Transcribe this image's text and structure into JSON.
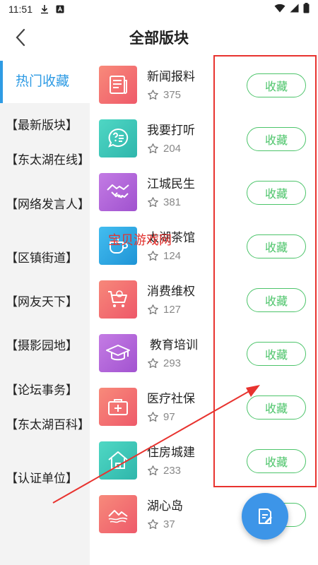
{
  "status_bar": {
    "time": "11:51"
  },
  "header": {
    "title": "全部版块"
  },
  "sidebar": {
    "items": [
      {
        "label": "热门收藏",
        "active": true
      },
      {
        "label": "【最新版块】"
      },
      {
        "label": "【东太湖在线】"
      },
      {
        "label": "【网络发言人】"
      },
      {
        "label": "【区镇街道】"
      },
      {
        "label": "【网友天下】"
      },
      {
        "label": "【摄影园地】"
      },
      {
        "label": "【论坛事务】"
      },
      {
        "label": "【东太湖百科】"
      },
      {
        "label": "【认证单位】"
      }
    ]
  },
  "forums": [
    {
      "name": "新闻报料",
      "count": "375",
      "button": "收藏",
      "icon": "newspaper-icon",
      "color": "#f36b6b"
    },
    {
      "name": "我要打听",
      "count": "204",
      "button": "收藏",
      "icon": "chat-question-icon",
      "color": "#3ec7b8"
    },
    {
      "name": "江城民生",
      "count": "381",
      "button": "收藏",
      "icon": "handshake-icon",
      "color": "#b468d8"
    },
    {
      "name": "太湖茶馆",
      "count": "124",
      "button": "收藏",
      "icon": "teacup-icon",
      "color": "#2ea7e0"
    },
    {
      "name": "消费维权",
      "count": "127",
      "button": "收藏",
      "icon": "shopping-cart-icon",
      "color": "#f26a6a"
    },
    {
      "name": "教育培训",
      "count": "293",
      "button": "收藏",
      "icon": "graduation-cap-icon",
      "color": "#b86ad8"
    },
    {
      "name": "医疗社保",
      "count": "97",
      "button": "收藏",
      "icon": "medical-kit-icon",
      "color": "#f26d6d"
    },
    {
      "name": "住房城建",
      "count": "233",
      "button": "收藏",
      "icon": "house-icon",
      "color": "#3fc9b9"
    },
    {
      "name": "湖心岛",
      "count": "37",
      "button": "收藏",
      "icon": "island-icon",
      "color": "#f26a6a"
    }
  ],
  "watermark": "宝贝游戏网",
  "annotation_color": "#e8332f"
}
